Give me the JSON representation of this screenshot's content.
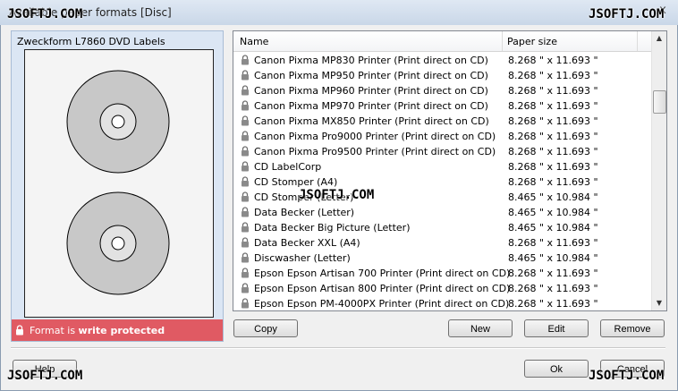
{
  "window": {
    "title": "Available paper formats [Disc]",
    "close_label": "x"
  },
  "watermark": {
    "text": "JSOFTJ.COM"
  },
  "preview": {
    "title": "Zweckform L7860 DVD Labels",
    "protect_prefix": "Format is ",
    "protect_strong": "write protected"
  },
  "list": {
    "columns": {
      "name": "Name",
      "size": "Paper size"
    },
    "rows": [
      {
        "name": "Canon Pixma MP830 Printer (Print direct on CD)",
        "size": "8.268 \" x 11.693 \""
      },
      {
        "name": "Canon Pixma MP950 Printer (Print direct on CD)",
        "size": "8.268 \" x 11.693 \""
      },
      {
        "name": "Canon Pixma MP960 Printer (Print direct on CD)",
        "size": "8.268 \" x 11.693 \""
      },
      {
        "name": "Canon Pixma MP970 Printer (Print direct on CD)",
        "size": "8.268 \" x 11.693 \""
      },
      {
        "name": "Canon Pixma MX850 Printer (Print direct on CD)",
        "size": "8.268 \" x 11.693 \""
      },
      {
        "name": "Canon Pixma Pro9000 Printer (Print direct on CD)",
        "size": "8.268 \" x 11.693 \""
      },
      {
        "name": "Canon Pixma Pro9500 Printer (Print direct on CD)",
        "size": "8.268 \" x 11.693 \""
      },
      {
        "name": "CD LabelCorp",
        "size": "8.268 \" x 11.693 \""
      },
      {
        "name": "CD Stomper (A4)",
        "size": "8.268 \" x 11.693 \""
      },
      {
        "name": "CD Stomper (Letter)",
        "size": "8.465 \" x 10.984 \""
      },
      {
        "name": "Data Becker (Letter)",
        "size": "8.465 \" x 10.984 \""
      },
      {
        "name": "Data Becker Big Picture (Letter)",
        "size": "8.465 \" x 10.984 \""
      },
      {
        "name": "Data Becker XXL (A4)",
        "size": "8.268 \" x 11.693 \""
      },
      {
        "name": "Discwasher (Letter)",
        "size": "8.465 \" x 10.984 \""
      },
      {
        "name": "Epson Epson Artisan 700 Printer (Print direct on CD)",
        "size": "8.268 \" x 11.693 \""
      },
      {
        "name": "Epson Epson Artisan 800 Printer (Print direct on CD)",
        "size": "8.268 \" x 11.693 \""
      },
      {
        "name": "Epson Epson PM-4000PX Printer (Print direct on CD)",
        "size": "8.268 \" x 11.693 \""
      }
    ]
  },
  "buttons": {
    "copy": "Copy",
    "new": "New",
    "edit": "Edit",
    "remove": "Remove",
    "help": "Help",
    "ok": "Ok",
    "cancel": "Cancel"
  },
  "colors": {
    "protect_bg": "#e05a63",
    "preview_bg": "#dbe6f4",
    "disc_gray": "#c8c8c8"
  }
}
